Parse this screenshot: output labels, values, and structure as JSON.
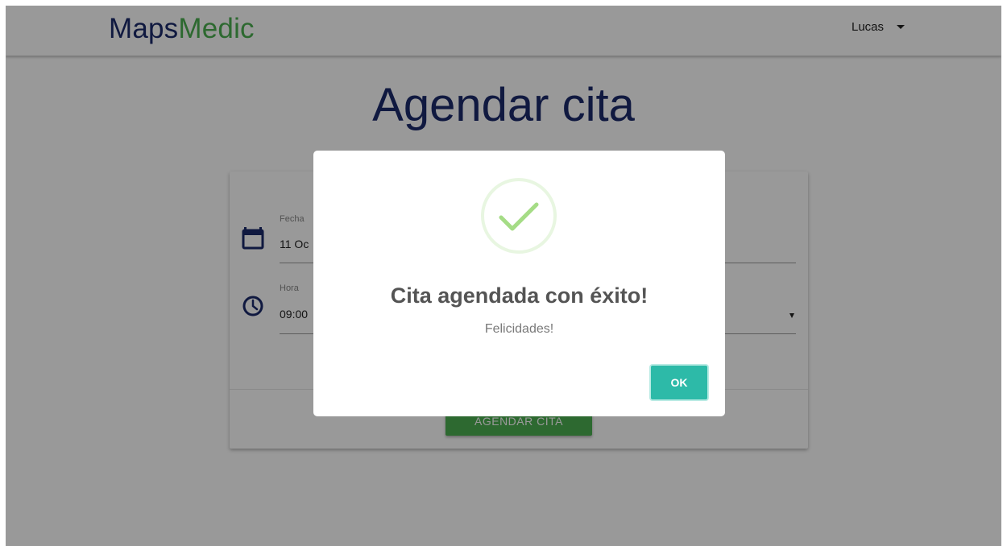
{
  "navbar": {
    "brand_part1": "Maps",
    "brand_part2": "Medic",
    "user_name": "Lucas"
  },
  "page": {
    "title": "Agendar cita"
  },
  "form": {
    "date_label": "Fecha",
    "date_value": "11 Oc",
    "time_label": "Hora",
    "time_value": "09:00",
    "submit_label": "AGENDAR CITA"
  },
  "modal": {
    "title": "Cita agendada con éxito!",
    "text": "Felicidades!",
    "ok_label": "OK"
  },
  "icons": {
    "calendar": "calendar-icon",
    "clock": "clock-icon",
    "success": "check-icon",
    "user_caret": "chevron-down-icon"
  },
  "colors": {
    "brand_dark": "#1b2a6b",
    "brand_green": "#4caf50",
    "ok_button": "#2dbaa8",
    "success_check": "#a5dc86"
  }
}
